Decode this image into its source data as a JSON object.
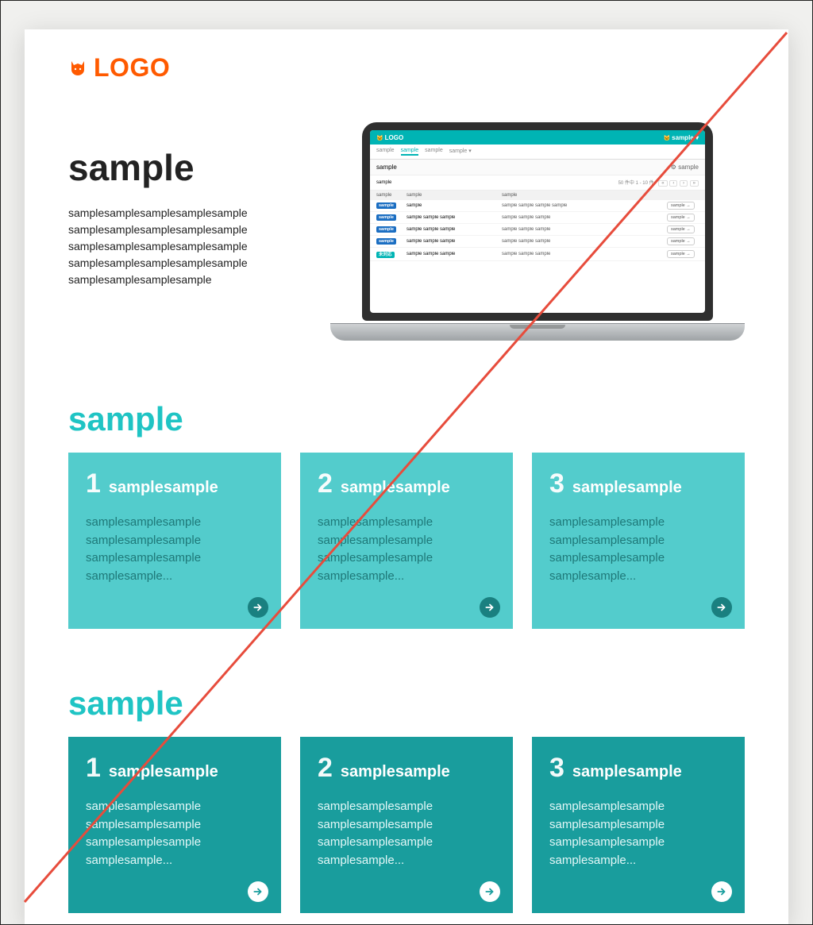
{
  "logo": {
    "text": "LOGO"
  },
  "hero": {
    "title": "sample",
    "body": "samplesamplesamplesamplesample\nsamplesamplesamplesamplesample\nsamplesamplesamplesamplesample\nsamplesamplesamplesamplesample\nsamplesamplesamplesample"
  },
  "laptop": {
    "brand": "LOGO",
    "user": "sample",
    "tabs": [
      "sample",
      "sample",
      "sample",
      "sample"
    ],
    "subbar_title": "sample",
    "subbar_action": "sample",
    "pager_label": "sample",
    "pager_range": "50 件中 1 - 10 件",
    "pager_controls": [
      "«",
      "‹",
      "›",
      "»"
    ],
    "th": {
      "c1": "sample",
      "c2": "sample",
      "c3": "sample",
      "c4": ""
    },
    "rows": [
      {
        "badge": "sample",
        "badgeType": "blue",
        "c2": "sample",
        "c3": "sample sample sample sample",
        "btn": "sample"
      },
      {
        "badge": "sample",
        "badgeType": "blue",
        "c2": "sample sample sample",
        "c3": "sample sample sample",
        "btn": "sample"
      },
      {
        "badge": "sample",
        "badgeType": "blue",
        "c2": "sample sample sample",
        "c3": "sample sample sample",
        "btn": "sample"
      },
      {
        "badge": "sample",
        "badgeType": "blue",
        "c2": "sample sample sample",
        "c3": "sample sample sample",
        "btn": "sample"
      },
      {
        "badge": "未対応",
        "badgeType": "teal",
        "c2": "sample sample sample",
        "c3": "sample sample sample",
        "btn": "sample"
      }
    ]
  },
  "section1": {
    "title": "sample",
    "cards": [
      {
        "num": "1",
        "title": "samplesample",
        "body": "samplesamplesample\nsamplesamplesample\nsamplesamplesample\nsamplesample..."
      },
      {
        "num": "2",
        "title": "samplesample",
        "body": "samplesamplesample\nsamplesamplesample\nsamplesamplesample\nsamplesample..."
      },
      {
        "num": "3",
        "title": "samplesample",
        "body": "samplesamplesample\nsamplesamplesample\nsamplesamplesample\nsamplesample..."
      }
    ]
  },
  "section2": {
    "title": "sample",
    "cards": [
      {
        "num": "1",
        "title": "samplesample",
        "body": "samplesamplesample\nsamplesamplesample\nsamplesamplesample\nsamplesample..."
      },
      {
        "num": "2",
        "title": "samplesample",
        "body": "samplesamplesample\nsamplesamplesample\nsamplesamplesample\nsamplesample..."
      },
      {
        "num": "3",
        "title": "samplesample",
        "body": "samplesamplesample\nsamplesamplesample\nsamplesamplesample\nsamplesample..."
      }
    ]
  }
}
